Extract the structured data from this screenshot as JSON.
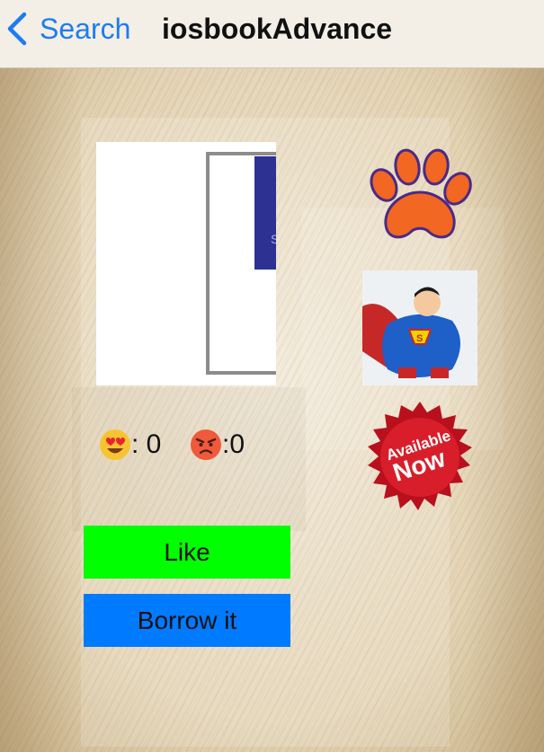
{
  "navbar": {
    "back_label": "Search",
    "title": "iosbookAdvance"
  },
  "images": {
    "book_cover": "book-cover-image",
    "clemson_paw": "tiger-paw-logo",
    "superman": "superman-cartoon",
    "available_badge": {
      "line1": "Available",
      "line2": "Now"
    }
  },
  "reactions": {
    "love": {
      "icon": "heart-eyes-emoji",
      "text": ": 0"
    },
    "angry": {
      "icon": "angry-face-emoji",
      "text": ":0"
    }
  },
  "buttons": {
    "like_label": "Like",
    "borrow_label": "Borrow it"
  },
  "colors": {
    "accent": "#1c7cf4",
    "like_button": "#00ff00",
    "borrow_button": "#007aff",
    "paw": "#f26722",
    "cover_band": "#2d3192"
  }
}
